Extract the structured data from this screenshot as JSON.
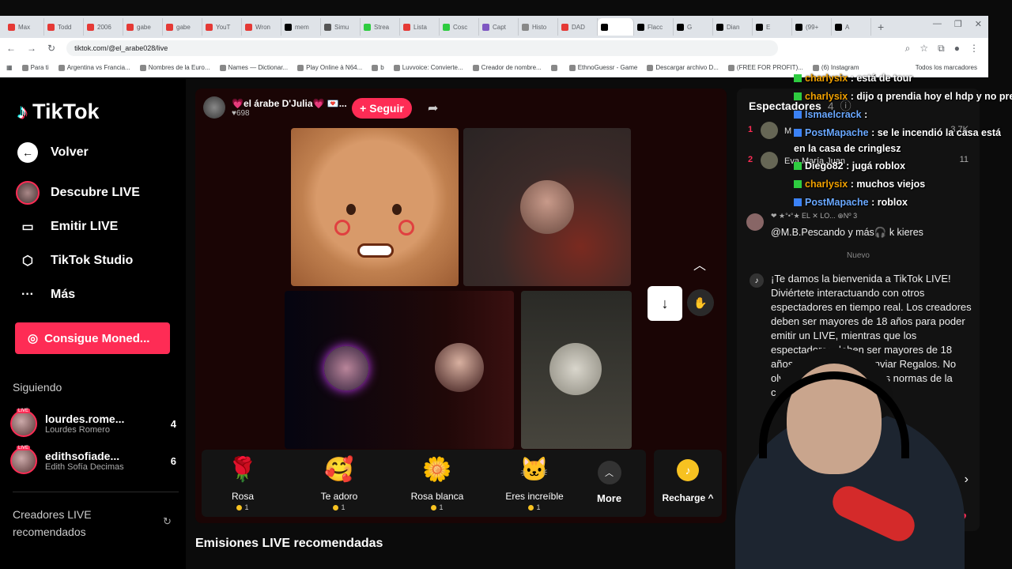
{
  "browser": {
    "tabs": [
      "Max",
      "Todd",
      "2006",
      "gabe",
      "gabe",
      "YouT",
      "Wron",
      "mem",
      "Simu",
      "Strea",
      "Lista",
      "Cosc",
      "Capt",
      "Histo",
      "DAD",
      "",
      "Flacc",
      "G",
      "Dian",
      "E",
      "(99+",
      "A"
    ],
    "url": "tiktok.com/@el_arabe028/live",
    "bookmarks": [
      "Para ti",
      "Argentina vs Francia...",
      "Nombres de la Euro...",
      "Names — Dictionar...",
      "Play Online à N64...",
      "b",
      "Luvvoice: Convierte...",
      "Creador de nombre...",
      "",
      "EthnoGuessr - Game",
      "Descargar archivo D...",
      "(FREE FOR PROFIT)...",
      "(6) Instagram"
    ],
    "all_bookmarks": "Todos los marcadores"
  },
  "sidebar": {
    "logo": "TikTok",
    "back": "Volver",
    "discover": "Descubre LIVE",
    "go_live": "Emitir LIVE",
    "studio": "TikTok Studio",
    "more": "Más",
    "coins_button": "Consigue Moned...",
    "following_title": "Siguiendo",
    "following": [
      {
        "handle": "lourdes.rome...",
        "name": "Lourdes Romero",
        "count": "4"
      },
      {
        "handle": "edithsofiade...",
        "name": "Edith Sofía Decimas",
        "count": "6"
      }
    ],
    "recommended_title": "Creadores LIVE recomendados",
    "live_tag": "LIVE"
  },
  "stream": {
    "host_name": "💗el árabe D'Julia💗 💌...",
    "likes": "♥698",
    "follow_label": "+ Seguir"
  },
  "gifts": [
    {
      "name": "Rosa",
      "cost": "1",
      "icon": "🌹"
    },
    {
      "name": "Te adoro",
      "cost": "1",
      "icon": "🥰"
    },
    {
      "name": "Rosa blanca",
      "cost": "1",
      "icon": "🌼"
    },
    {
      "name": "Eres increíble",
      "cost": "1",
      "icon": "🐱"
    }
  ],
  "more_label": "More",
  "recharge_label": "Recharge ^",
  "recommended_streams": "Emisiones LIVE recomendadas",
  "chat": {
    "spectators_title": "Espectadores",
    "spectators_count": "4",
    "ranking": [
      {
        "rank": "1",
        "name": "M",
        "score": "3.7K"
      },
      {
        "rank": "2",
        "name": "Eva María Juan",
        "score": "11"
      }
    ],
    "comment_badges": "❤ ★°•°★ EL ✕ LO... ⊕Nº 3",
    "comment_text": "@M.B.Pescando y más🎧  k kieres",
    "new_label": "Nuevo",
    "welcome": "¡Te damos la bienvenida a TikTok LIVE! Diviértete interactuando con otros espectadores en tiempo real. Los creadores deben ser mayores de 18 años para poder emitir un LIVE, mientras que los espectadores deben ser mayores de 18 años para recargar y enviar Regalos. No olvides de seguir nuestras normas de la comunidad."
  },
  "overlay_chat": [
    {
      "user": "charlysix",
      "msg": ": está de tour",
      "color": "orange"
    },
    {
      "user": "charlysix",
      "msg": ": dijo q prendia hoy el hdp y no prer",
      "color": "orange"
    },
    {
      "user": "Ismaelcrack",
      "msg": ":",
      "color": "blue"
    },
    {
      "user": "PostMapache",
      "msg": ": se le incendió la casa está",
      "color": "blue"
    },
    {
      "user": "",
      "msg": "en la casa de cringlesz",
      "color": "white"
    },
    {
      "user": "Diego82",
      "msg": ": jugá roblox",
      "color": "white"
    },
    {
      "user": "charlysix",
      "msg": ": muchos viejos",
      "color": "orange"
    },
    {
      "user": "PostMapache",
      "msg": ": roblox",
      "color": "blue"
    }
  ]
}
